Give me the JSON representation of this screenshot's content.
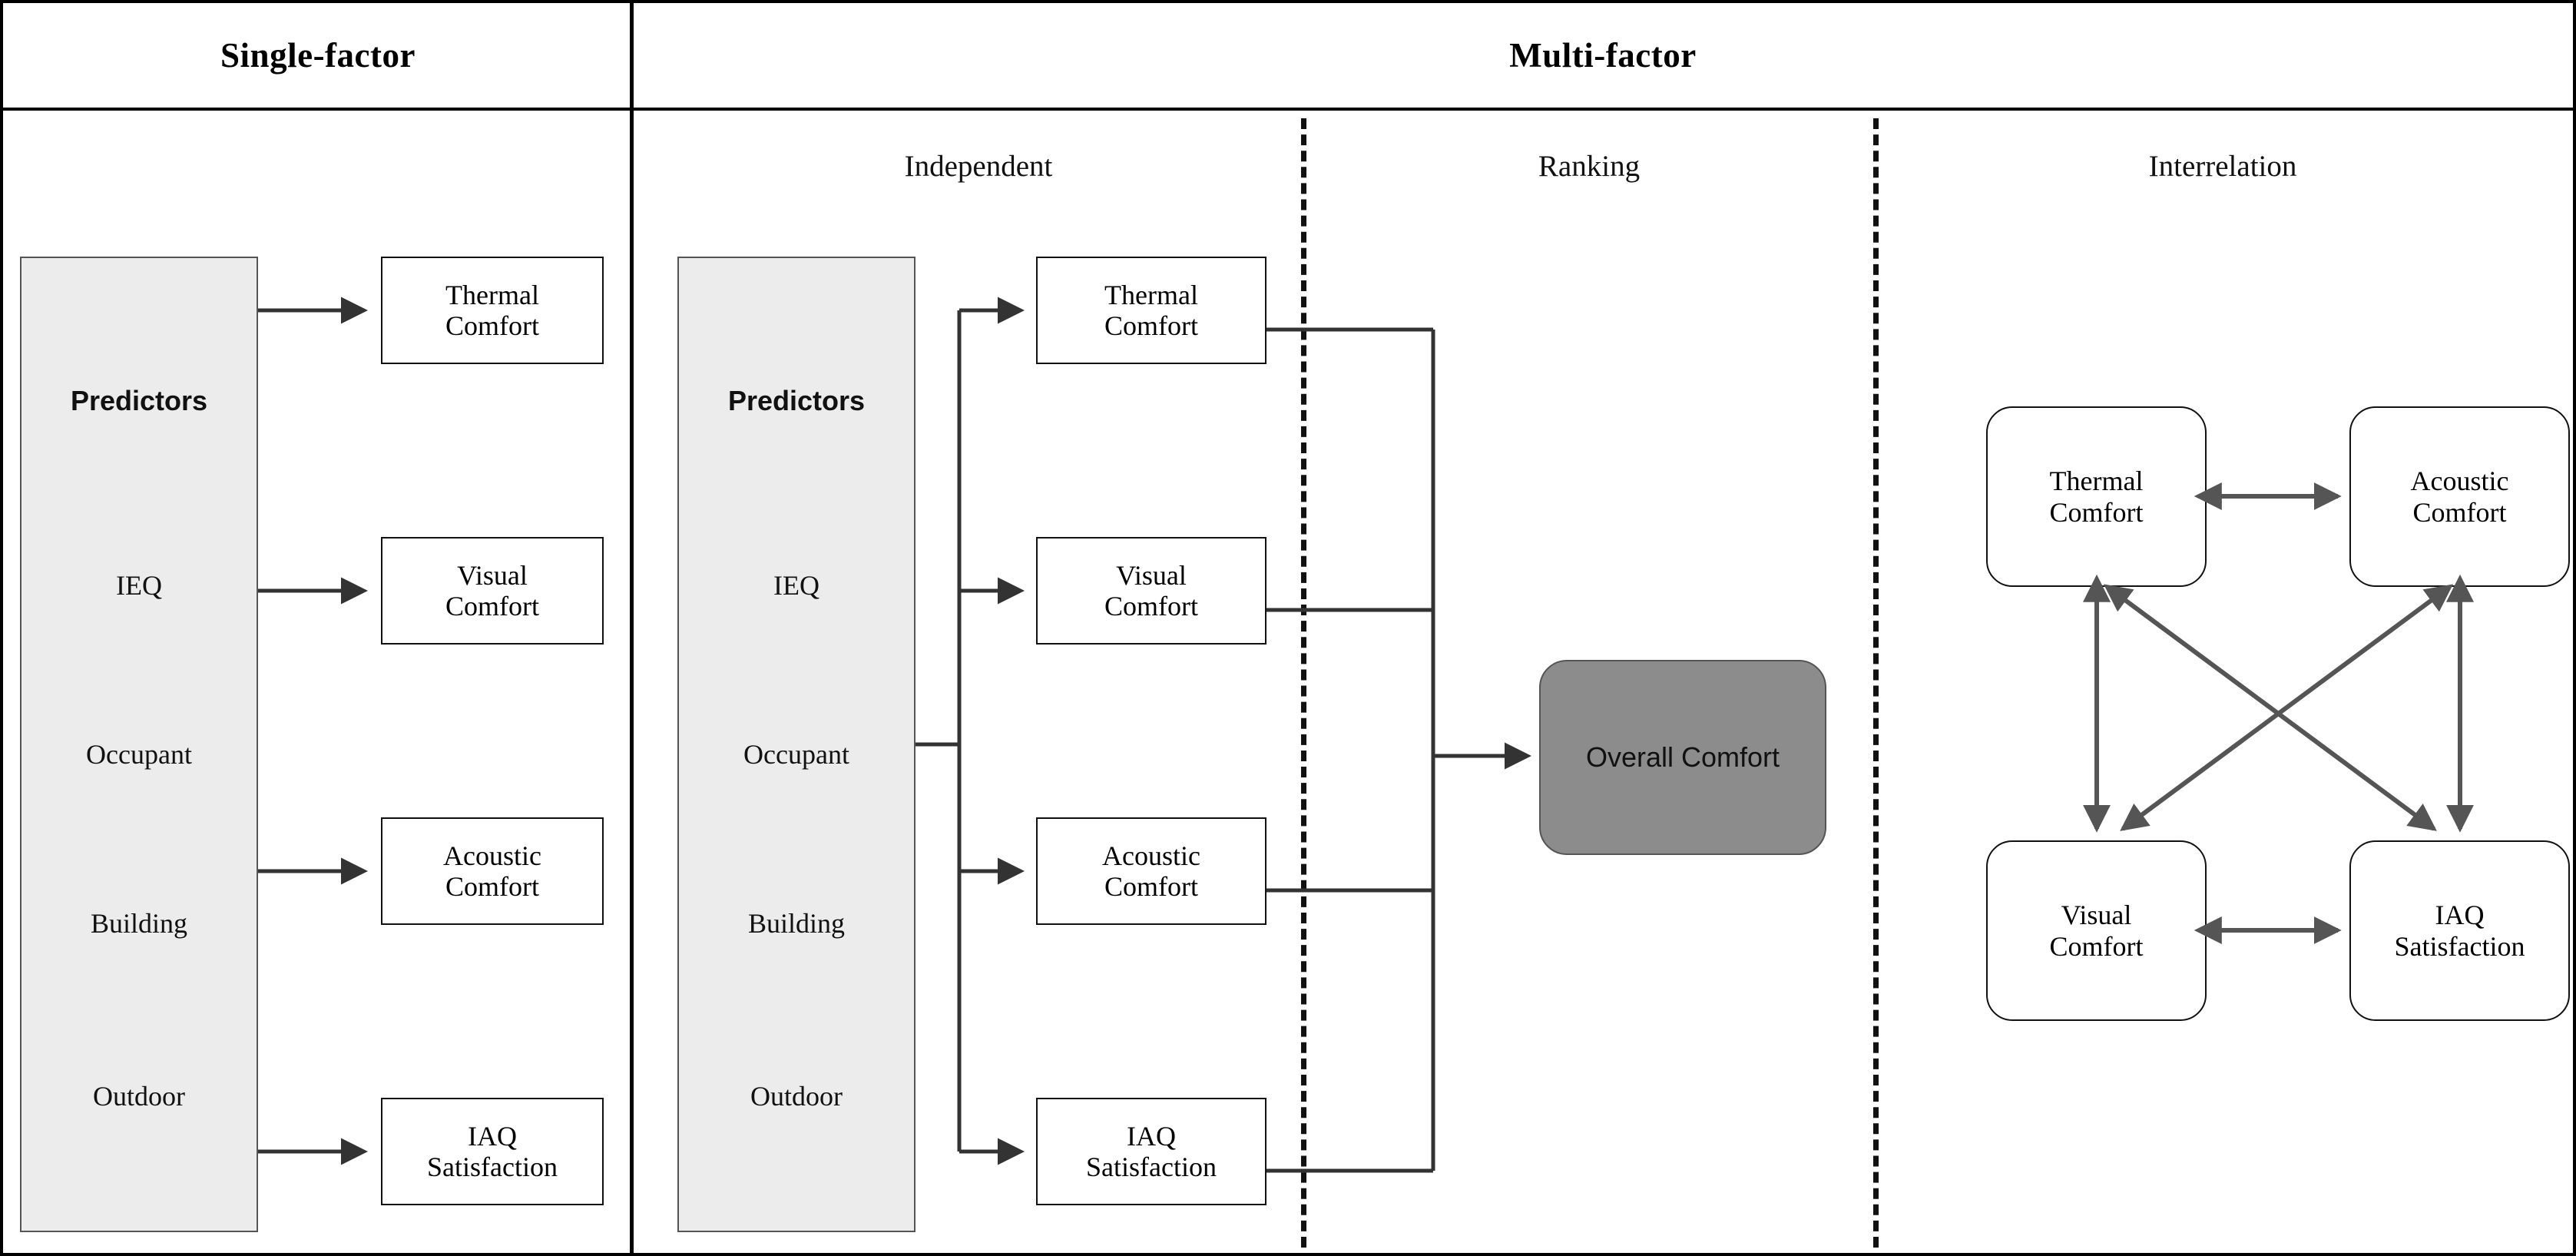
{
  "header": {
    "single_factor": "Single-factor",
    "multi_factor": "Multi-factor"
  },
  "subheaders": {
    "independent": "Independent",
    "ranking": "Ranking",
    "interrelation": "Interrelation"
  },
  "predictors": {
    "title": "Predictors",
    "items": [
      "IEQ",
      "Occupant",
      "Building",
      "Outdoor"
    ],
    "fill_color": "#ececec"
  },
  "single_factor_outcomes": [
    {
      "line1": "Thermal",
      "line2": "Comfort"
    },
    {
      "line1": "Visual",
      "line2": "Comfort"
    },
    {
      "line1": "Acoustic",
      "line2": "Comfort"
    },
    {
      "line1": "IAQ",
      "line2": "Satisfaction"
    }
  ],
  "multi_factor_outcomes": [
    {
      "line1": "Thermal",
      "line2": "Comfort"
    },
    {
      "line1": "Visual",
      "line2": "Comfort"
    },
    {
      "line1": "Acoustic",
      "line2": "Comfort"
    },
    {
      "line1": "IAQ",
      "line2": "Satisfaction"
    }
  ],
  "ranking": {
    "target_label": "Overall Comfort",
    "target_color": "#8c8c8c"
  },
  "interrelation": {
    "nodes": [
      {
        "line1": "Thermal",
        "line2": "Comfort"
      },
      {
        "line1": "Acoustic",
        "line2": "Comfort"
      },
      {
        "line1": "Visual",
        "line2": "Comfort"
      },
      {
        "line1": "IAQ",
        "line2": "Satisfaction"
      }
    ]
  },
  "style": {
    "line_color": "#555555",
    "border_color": "#111111"
  }
}
